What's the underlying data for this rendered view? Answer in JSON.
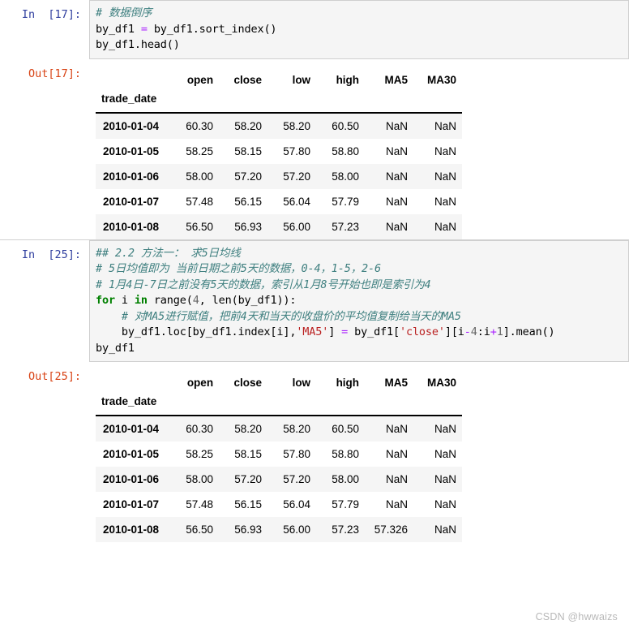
{
  "watermark": "CSDN @hwwaizs",
  "cells": [
    {
      "in_prompt": "In  [17]:",
      "out_prompt": "Out[17]:",
      "code_lines": [
        [
          {
            "t": "comment",
            "s": "# 数据倒序"
          }
        ],
        [
          {
            "t": "plain",
            "s": "by_df1 "
          },
          {
            "t": "op",
            "s": "="
          },
          {
            "t": "plain",
            "s": " by_df1.sort_index()"
          }
        ],
        [
          {
            "t": "plain",
            "s": "by_df1.head()"
          }
        ]
      ],
      "table": {
        "index_name": "trade_date",
        "columns": [
          "open",
          "close",
          "low",
          "high",
          "MA5",
          "MA30"
        ],
        "rows": [
          {
            "index": "2010-01-04",
            "values": [
              "60.30",
              "58.20",
              "58.20",
              "60.50",
              "NaN",
              "NaN"
            ]
          },
          {
            "index": "2010-01-05",
            "values": [
              "58.25",
              "58.15",
              "57.80",
              "58.80",
              "NaN",
              "NaN"
            ]
          },
          {
            "index": "2010-01-06",
            "values": [
              "58.00",
              "57.20",
              "57.20",
              "58.00",
              "NaN",
              "NaN"
            ]
          },
          {
            "index": "2010-01-07",
            "values": [
              "57.48",
              "56.15",
              "56.04",
              "57.79",
              "NaN",
              "NaN"
            ]
          },
          {
            "index": "2010-01-08",
            "values": [
              "56.50",
              "56.93",
              "56.00",
              "57.23",
              "NaN",
              "NaN"
            ]
          }
        ]
      }
    },
    {
      "in_prompt": "In  [25]:",
      "out_prompt": "Out[25]:",
      "code_lines": [
        [
          {
            "t": "comment",
            "s": "## 2.2 方法一： 求5日均线"
          }
        ],
        [
          {
            "t": "comment",
            "s": "# 5日均值即为 当前日期之前5天的数据，0-4，1-5，2-6"
          }
        ],
        [
          {
            "t": "comment",
            "s": "# 1月4日-7日之前没有5天的数据，索引从1月8号开始也即是索引为4"
          }
        ],
        [
          {
            "t": "keyword",
            "s": "for"
          },
          {
            "t": "plain",
            "s": " i "
          },
          {
            "t": "keyword",
            "s": "in"
          },
          {
            "t": "plain",
            "s": " range("
          },
          {
            "t": "number",
            "s": "4"
          },
          {
            "t": "plain",
            "s": ", "
          },
          {
            "t": "builtin",
            "s": "len"
          },
          {
            "t": "plain",
            "s": "(by_df1)):"
          }
        ],
        [
          {
            "t": "plain",
            "s": "    "
          },
          {
            "t": "comment",
            "s": "# 对MA5进行赋值，把前4天和当天的收盘价的平均值复制给当天的MA5"
          }
        ],
        [
          {
            "t": "plain",
            "s": "    by_df1.loc[by_df1.index[i],"
          },
          {
            "t": "string",
            "s": "'MA5'"
          },
          {
            "t": "plain",
            "s": "] "
          },
          {
            "t": "op",
            "s": "="
          },
          {
            "t": "plain",
            "s": " by_df1["
          },
          {
            "t": "string",
            "s": "'close'"
          },
          {
            "t": "plain",
            "s": "][i"
          },
          {
            "t": "op",
            "s": "-"
          },
          {
            "t": "number",
            "s": "4"
          },
          {
            "t": "plain",
            "s": ":i"
          },
          {
            "t": "op",
            "s": "+"
          },
          {
            "t": "number",
            "s": "1"
          },
          {
            "t": "plain",
            "s": "].mean()"
          }
        ],
        [
          {
            "t": "plain",
            "s": "by_df1"
          }
        ]
      ],
      "table": {
        "index_name": "trade_date",
        "columns": [
          "open",
          "close",
          "low",
          "high",
          "MA5",
          "MA30"
        ],
        "rows": [
          {
            "index": "2010-01-04",
            "values": [
              "60.30",
              "58.20",
              "58.20",
              "60.50",
              "NaN",
              "NaN"
            ]
          },
          {
            "index": "2010-01-05",
            "values": [
              "58.25",
              "58.15",
              "57.80",
              "58.80",
              "NaN",
              "NaN"
            ]
          },
          {
            "index": "2010-01-06",
            "values": [
              "58.00",
              "57.20",
              "57.20",
              "58.00",
              "NaN",
              "NaN"
            ]
          },
          {
            "index": "2010-01-07",
            "values": [
              "57.48",
              "56.15",
              "56.04",
              "57.79",
              "NaN",
              "NaN"
            ]
          },
          {
            "index": "2010-01-08",
            "values": [
              "56.50",
              "56.93",
              "56.00",
              "57.23",
              "57.326",
              "NaN"
            ]
          }
        ]
      }
    }
  ]
}
